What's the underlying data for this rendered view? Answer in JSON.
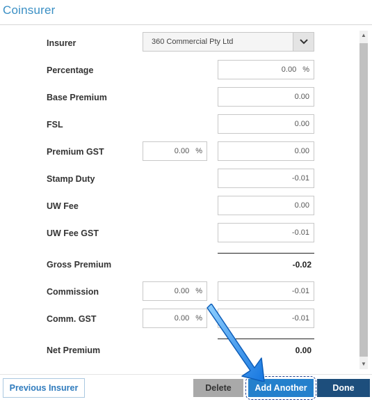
{
  "dialog": {
    "title": "Coinsurer"
  },
  "form": {
    "insurer": {
      "label": "Insurer",
      "value": "360 Commercial Pty Ltd"
    },
    "percentage": {
      "label": "Percentage",
      "value": "0.00",
      "unit": "%"
    },
    "base_premium": {
      "label": "Base Premium",
      "value": "0.00"
    },
    "fsl": {
      "label": "FSL",
      "value": "0.00"
    },
    "premium_gst": {
      "label": "Premium GST",
      "rate": "0.00",
      "unit": "%",
      "value": "0.00"
    },
    "stamp_duty": {
      "label": "Stamp Duty",
      "value": "-0.01"
    },
    "uw_fee": {
      "label": "UW Fee",
      "value": "0.00"
    },
    "uw_fee_gst": {
      "label": "UW Fee GST",
      "value": "-0.01"
    },
    "gross_premium": {
      "label": "Gross Premium",
      "value": "-0.02"
    },
    "commission": {
      "label": "Commission",
      "rate": "0.00",
      "unit": "%",
      "value": "-0.01"
    },
    "comm_gst": {
      "label": "Comm. GST",
      "rate": "0.00",
      "unit": "%",
      "value": "-0.01"
    },
    "net_premium": {
      "label": "Net Premium",
      "value": "0.00"
    }
  },
  "footer": {
    "previous_label": "Previous Insurer",
    "delete_label": "Delete",
    "add_another_label": "Add Another",
    "done_label": "Done"
  },
  "icons": {
    "insurer_dropdown": "chevron-down-icon",
    "scroll_up": "arrow-up-icon",
    "scroll_down": "arrow-down-icon",
    "pointer": "blue-arrow-pointer-icon"
  },
  "colors": {
    "title": "#3a8fc4",
    "add_button": "#2480cc",
    "done_button": "#1d4e7c",
    "delete_button": "#a9a9a9",
    "pointer": "#1e8ff0"
  }
}
